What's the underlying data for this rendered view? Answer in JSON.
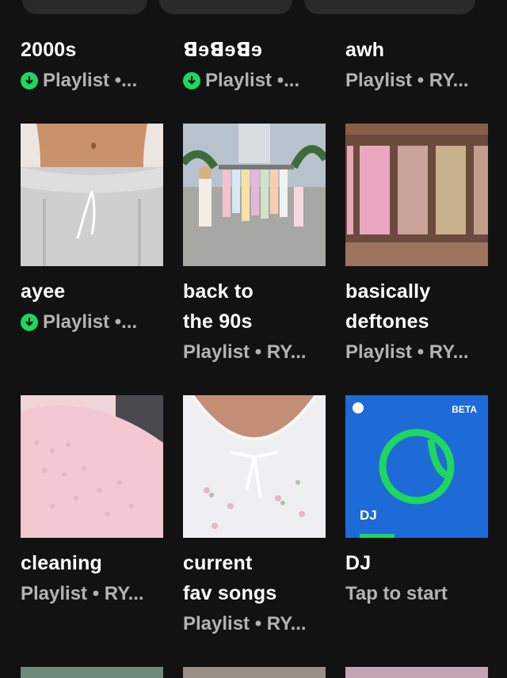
{
  "items": [
    {
      "title": "2000s",
      "subtitle": "Playlist •...",
      "downloaded": true
    },
    {
      "title": "ꓭɘꓭɘꓭɘ",
      "subtitle": "Playlist •...",
      "downloaded": true
    },
    {
      "title": "awh",
      "subtitle": "Playlist • RY...",
      "downloaded": false
    },
    {
      "title": "ayee",
      "subtitle": "Playlist •...",
      "downloaded": true
    },
    {
      "title_line1": "back to",
      "title_line2": "the 90s",
      "subtitle": "Playlist • RY...",
      "downloaded": false
    },
    {
      "title_line1": "basically",
      "title_line2": "deftones",
      "subtitle": "Playlist • RY...",
      "downloaded": false
    },
    {
      "title": "cleaning",
      "subtitle": "Playlist • RY...",
      "downloaded": false
    },
    {
      "title_line1": "current",
      "title_line2": "fav songs",
      "subtitle": "Playlist • RY...",
      "downloaded": false
    },
    {
      "title": "DJ",
      "subtitle": "Tap to start",
      "cover_label": "DJ",
      "badge": "BETA"
    }
  ],
  "icons": {
    "downloaded": "download-arrow-icon",
    "spotify": "spotify-logo-icon"
  },
  "colors": {
    "background": "#121212",
    "accent": "#1ed760",
    "subtext": "#b3b3b3",
    "dj_cover": "#1e6bd8"
  }
}
